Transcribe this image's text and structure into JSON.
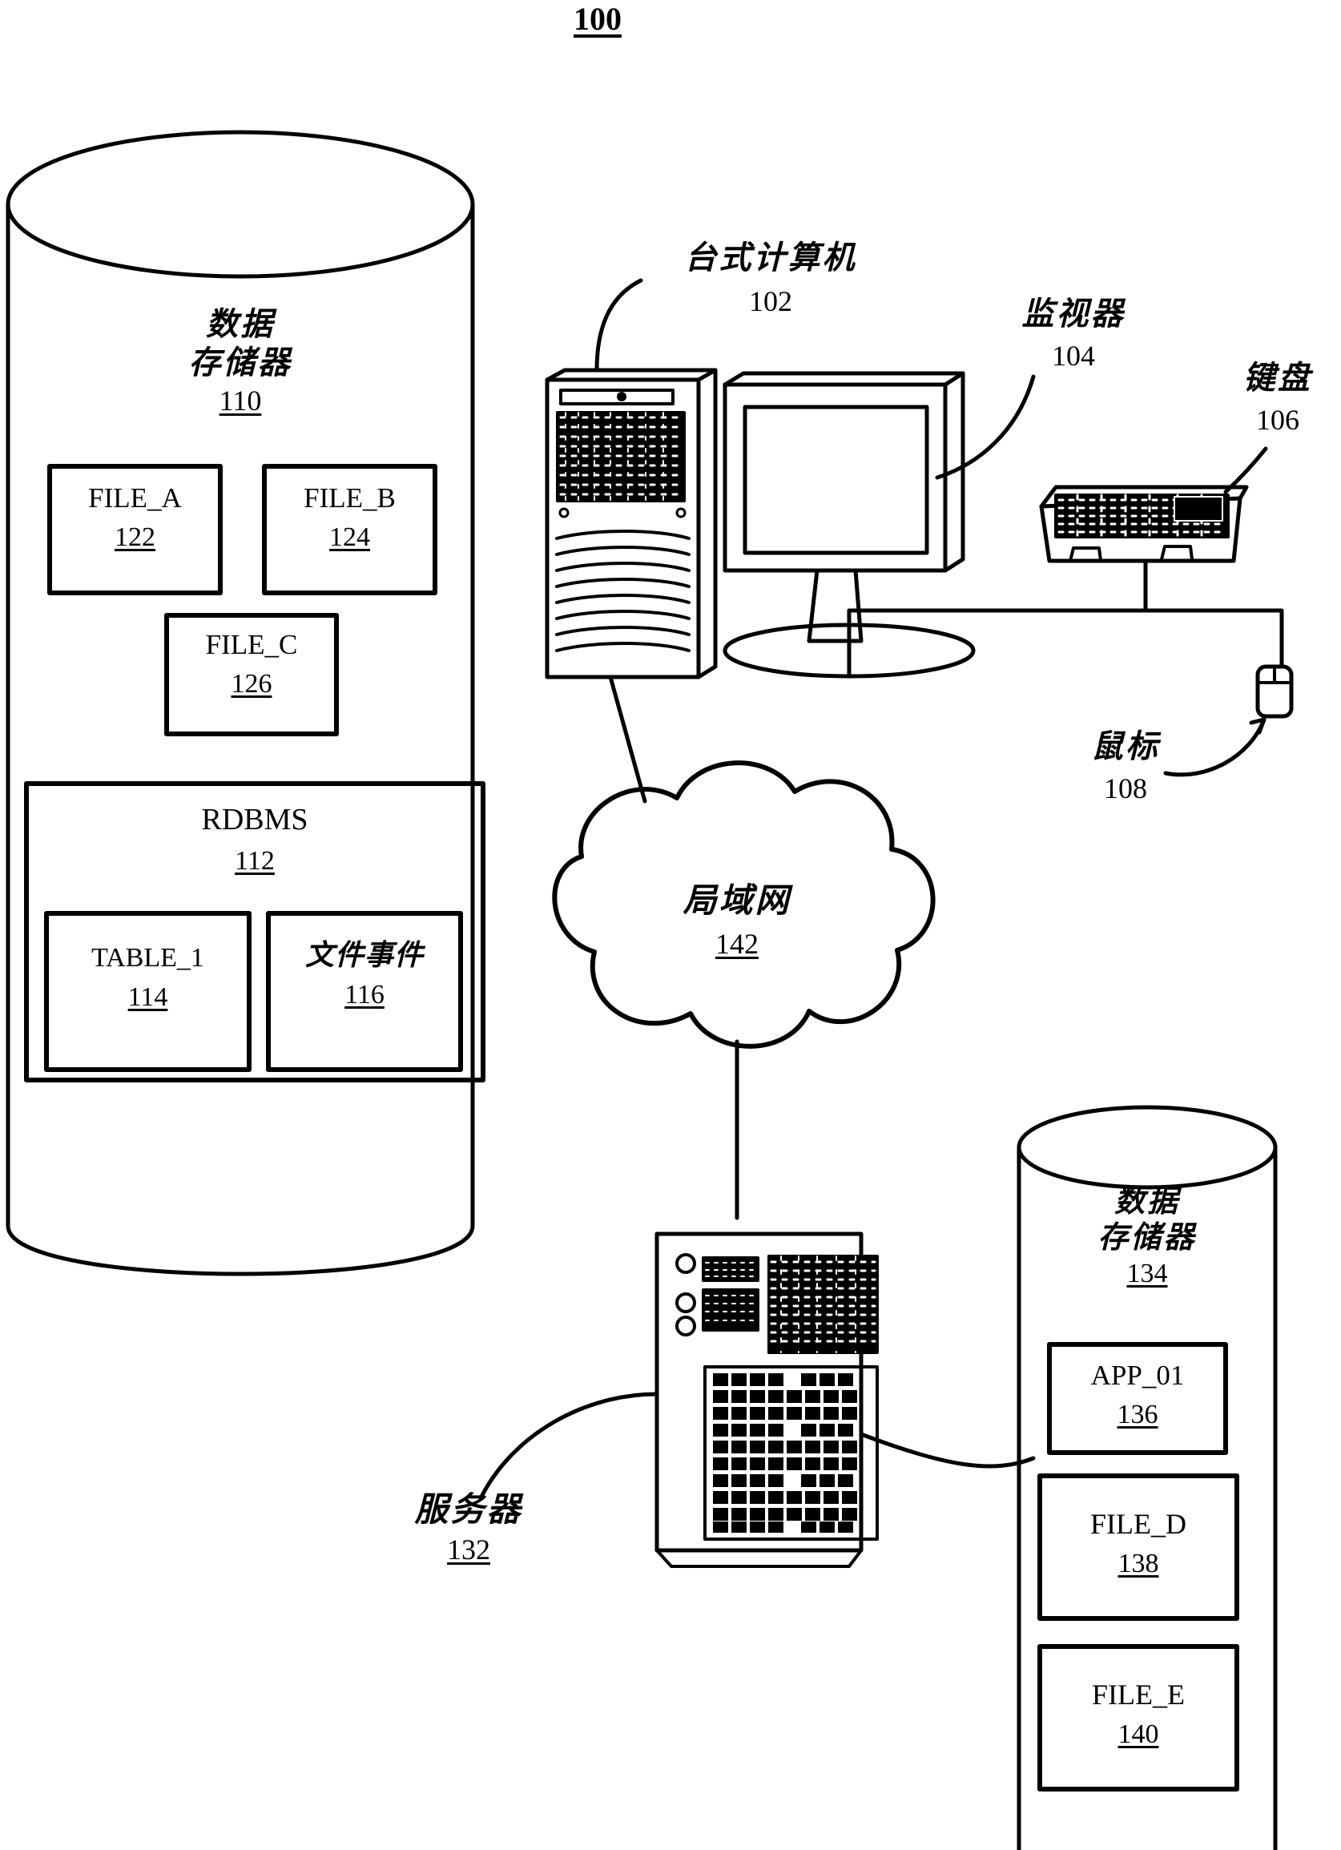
{
  "figure": {
    "number": "100"
  },
  "left_datastore": {
    "name": "数据",
    "name2": "存储器",
    "ref": "110",
    "files": [
      {
        "label": "FILE_A",
        "ref": "122"
      },
      {
        "label": "FILE_B",
        "ref": "124"
      },
      {
        "label": "FILE_C",
        "ref": "126"
      }
    ],
    "rdbms": {
      "label": "RDBMS",
      "ref": "112",
      "children": [
        {
          "label": "TABLE_1",
          "ref": "114"
        },
        {
          "label": "文件事件",
          "ref": "116"
        }
      ]
    }
  },
  "desktop": {
    "label": "台式计算机",
    "ref": "102"
  },
  "monitor": {
    "label": "监视器",
    "ref": "104"
  },
  "keyboard": {
    "label": "键盘",
    "ref": "106"
  },
  "mouse": {
    "label": "鼠标",
    "ref": "108"
  },
  "lan": {
    "label": "局域网",
    "ref": "142"
  },
  "server": {
    "label": "服务器",
    "ref": "132"
  },
  "right_datastore": {
    "name": "数据",
    "name2": "存储器",
    "ref": "134",
    "items": [
      {
        "label": "APP_01",
        "ref": "136"
      },
      {
        "label": "FILE_D",
        "ref": "138"
      },
      {
        "label": "FILE_E",
        "ref": "140"
      }
    ]
  }
}
